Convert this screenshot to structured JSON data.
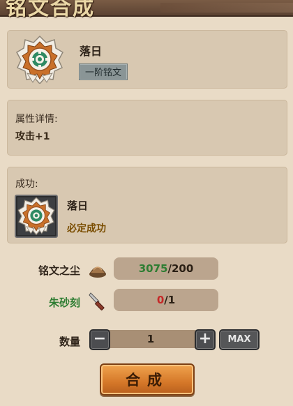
{
  "header": {
    "title": "铭文合成"
  },
  "item": {
    "name": "落日",
    "tier": "一阶铭文"
  },
  "attributes": {
    "label": "属性详情:",
    "value": "攻击+1"
  },
  "success": {
    "label": "成功:",
    "name": "落日",
    "status": "必定成功"
  },
  "materials": [
    {
      "label": "铭文之尘",
      "owned": "3075",
      "required": "200",
      "icon": "dust-pile-icon"
    },
    {
      "label": "朱砂刻",
      "owned": "0",
      "required": "1",
      "icon": "carving-knife-icon"
    }
  ],
  "quantity": {
    "label": "数量",
    "value": "1",
    "minus": "−",
    "plus": "+",
    "max_label": "MAX"
  },
  "action": {
    "combine_label": "合成"
  },
  "colors": {
    "owned_ok": "#2e7d32",
    "owned_short": "#c62828",
    "button": "#d57829"
  }
}
